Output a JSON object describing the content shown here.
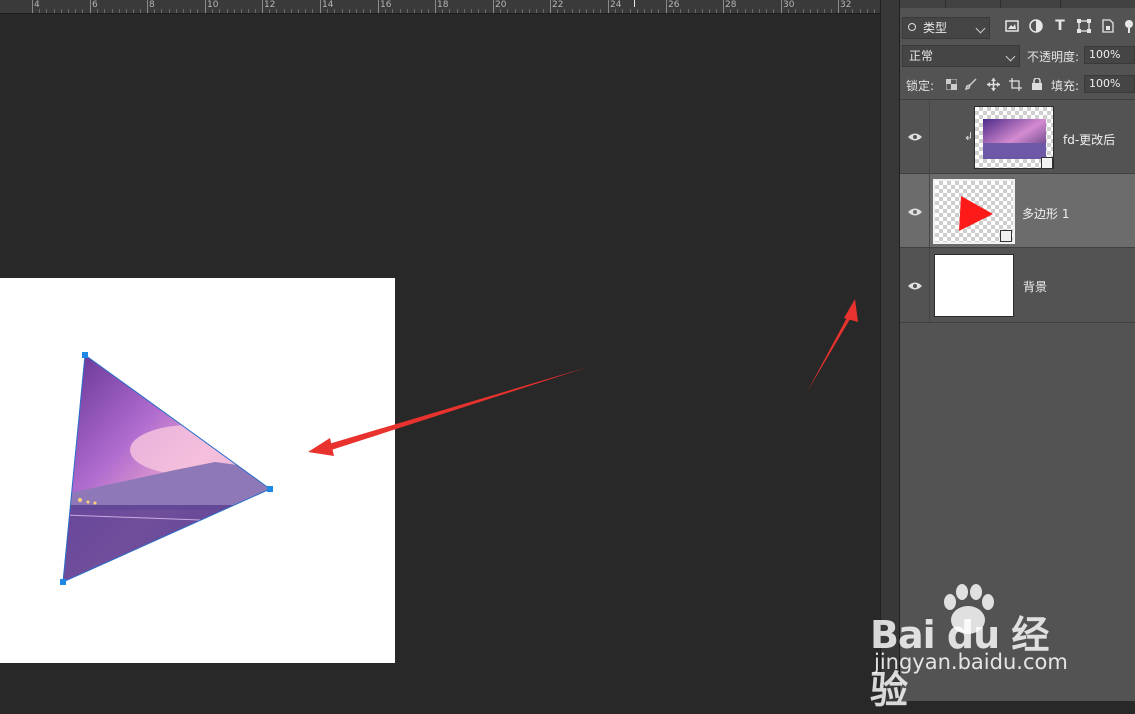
{
  "ruler": {
    "labels": [
      "4",
      "6",
      "8",
      "10",
      "12",
      "14",
      "16",
      "18",
      "20",
      "22",
      "24",
      "26",
      "28",
      "30",
      "32"
    ]
  },
  "layers_panel": {
    "filter_kind": "类型",
    "blend_mode": "正常",
    "opacity_label": "不透明度:",
    "opacity_value": "100%",
    "lock_label": "锁定:",
    "fill_label": "填充:",
    "fill_value": "100%",
    "layers": [
      {
        "name": "fd-更改后",
        "selected": false,
        "clipped": true
      },
      {
        "name": "多边形 1",
        "selected": true,
        "clipped": false
      },
      {
        "name": "背景",
        "selected": false,
        "clipped": false
      }
    ]
  },
  "colors": {
    "canvas_bg": "#282828",
    "panel_bg": "#535353",
    "selected_layer": "#6c6c6c",
    "annotation_arrow": "#e8322e",
    "path_handle": "#1e88e5",
    "shape_red": "#ff1a1a"
  },
  "watermark": {
    "brand": "Bai du 经验",
    "url": "jingyan.baidu.com"
  }
}
